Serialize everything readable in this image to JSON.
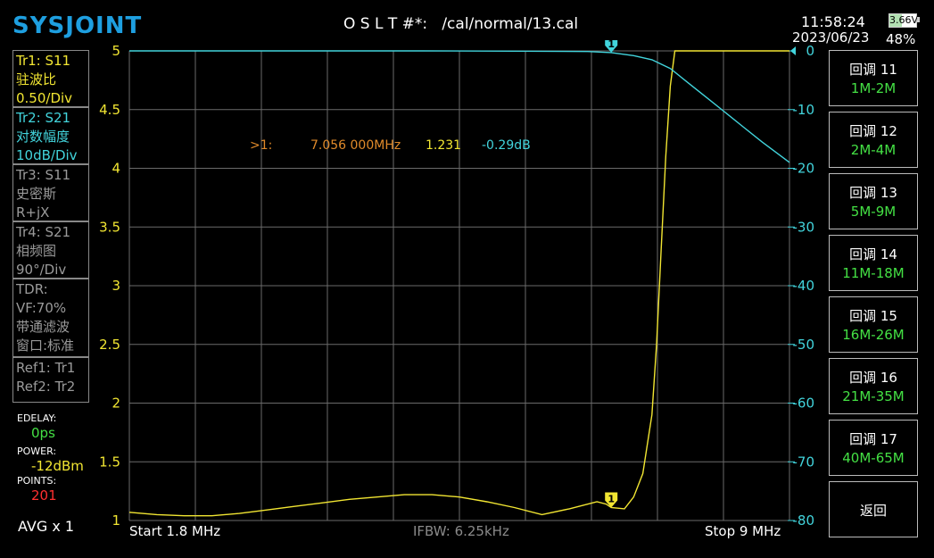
{
  "header": {
    "logo": "SYSJOINT",
    "cal_state": "O S L T #*:   /cal/normal/13.cal",
    "time": "11:58:24",
    "date": "2023/06/23",
    "battery_voltage": "3.66V",
    "battery_percent": "48%",
    "battery_level": 0.48
  },
  "traces": {
    "tr1": {
      "name": "Tr1:   S11",
      "format": "驻波比",
      "scale": "0.50/Div"
    },
    "tr2": {
      "name": "Tr2:   S21",
      "format": "对数幅度",
      "scale": "10dB/Div"
    },
    "tr3": {
      "name": "Tr3:   S11",
      "format": "史密斯",
      "scale": "R+jX"
    },
    "tr4": {
      "name": "Tr4:   S21",
      "format": "相频图",
      "scale": "90°/Div"
    },
    "tdr": {
      "title": "TDR:",
      "vf": "VF:70%",
      "mode": "带通滤波",
      "window": "窗口:标准"
    },
    "refs": {
      "ref1": "Ref1:  Tr1",
      "ref2": "Ref2:  Tr2"
    }
  },
  "settings": {
    "edelay_label": "EDELAY:",
    "edelay_value": "0ps",
    "power_label": "POWER:",
    "power_value": "-12dBm",
    "points_label": "POINTS:",
    "points_value": "201",
    "avg": "AVG x 1"
  },
  "marker_readout": {
    "id": ">1:",
    "freq": "7.056 000MHz",
    "swr": "1.231",
    "mag": "-0.29dB"
  },
  "bottom": {
    "start": "Start   1.8 MHz",
    "ifbw": "IFBW: 6.25kHz",
    "stop": "Stop   9 MHz"
  },
  "menu": [
    {
      "title": "回调 11",
      "range": "1M-2M"
    },
    {
      "title": "回调 12",
      "range": "2M-4M"
    },
    {
      "title": "回调 13",
      "range": "5M-9M"
    },
    {
      "title": "回调 14",
      "range": "11M-18M"
    },
    {
      "title": "回调 15",
      "range": "16M-26M"
    },
    {
      "title": "回调 16",
      "range": "21M-35M"
    },
    {
      "title": "回调 17",
      "range": "40M-65M"
    },
    {
      "title": "返回",
      "range": ""
    }
  ],
  "chart_data": {
    "type": "line",
    "xlim": [
      1.8,
      9
    ],
    "x_unit": "MHz",
    "grid": true,
    "left_axis": {
      "ticks": [
        "5",
        "4.5",
        "4",
        "3.5",
        "3",
        "2.5",
        "2",
        "1.5",
        "1"
      ],
      "ylim": [
        1,
        5
      ],
      "color": "#f2e632"
    },
    "right_axis": {
      "ticks": [
        "0",
        "-10",
        "-20",
        "-30",
        "-40",
        "-50",
        "-60",
        "-70",
        "-80"
      ],
      "ylim": [
        -80,
        0
      ],
      "color": "#42d4dc"
    },
    "series": [
      {
        "name": "Tr1 S11",
        "axis": "left",
        "color": "#f2e632",
        "x": [
          1.8,
          2.1,
          2.4,
          2.7,
          3.0,
          3.3,
          3.6,
          3.9,
          4.2,
          4.5,
          4.8,
          5.1,
          5.4,
          5.7,
          6.0,
          6.3,
          6.6,
          6.9,
          7.0,
          7.056,
          7.2,
          7.3,
          7.4,
          7.5,
          7.55,
          7.6,
          7.65,
          7.7,
          7.75,
          8.0,
          9.0
        ],
        "y": [
          1.07,
          1.05,
          1.04,
          1.04,
          1.06,
          1.09,
          1.12,
          1.15,
          1.18,
          1.2,
          1.22,
          1.22,
          1.2,
          1.16,
          1.11,
          1.05,
          1.1,
          1.16,
          1.14,
          1.11,
          1.1,
          1.2,
          1.4,
          1.9,
          2.5,
          3.3,
          4.1,
          4.7,
          5.0,
          5.0,
          5.0
        ]
      },
      {
        "name": "Tr2 S21",
        "axis": "right",
        "color": "#42d4dc",
        "x": [
          1.8,
          3.0,
          4.0,
          5.0,
          6.0,
          6.8,
          7.056,
          7.3,
          7.5,
          7.7,
          7.9,
          8.1,
          8.3,
          8.5,
          8.7,
          9.0
        ],
        "y": [
          0,
          0,
          0,
          0,
          -0.05,
          -0.1,
          -0.29,
          -0.8,
          -1.5,
          -3.0,
          -5.5,
          -8.0,
          -10.5,
          -13.0,
          -15.5,
          -19.0
        ]
      }
    ],
    "markers": [
      {
        "id": "1",
        "x": 7.056,
        "trace": "Tr2"
      },
      {
        "id": "1",
        "x": 7.056,
        "trace": "Tr1"
      }
    ]
  }
}
